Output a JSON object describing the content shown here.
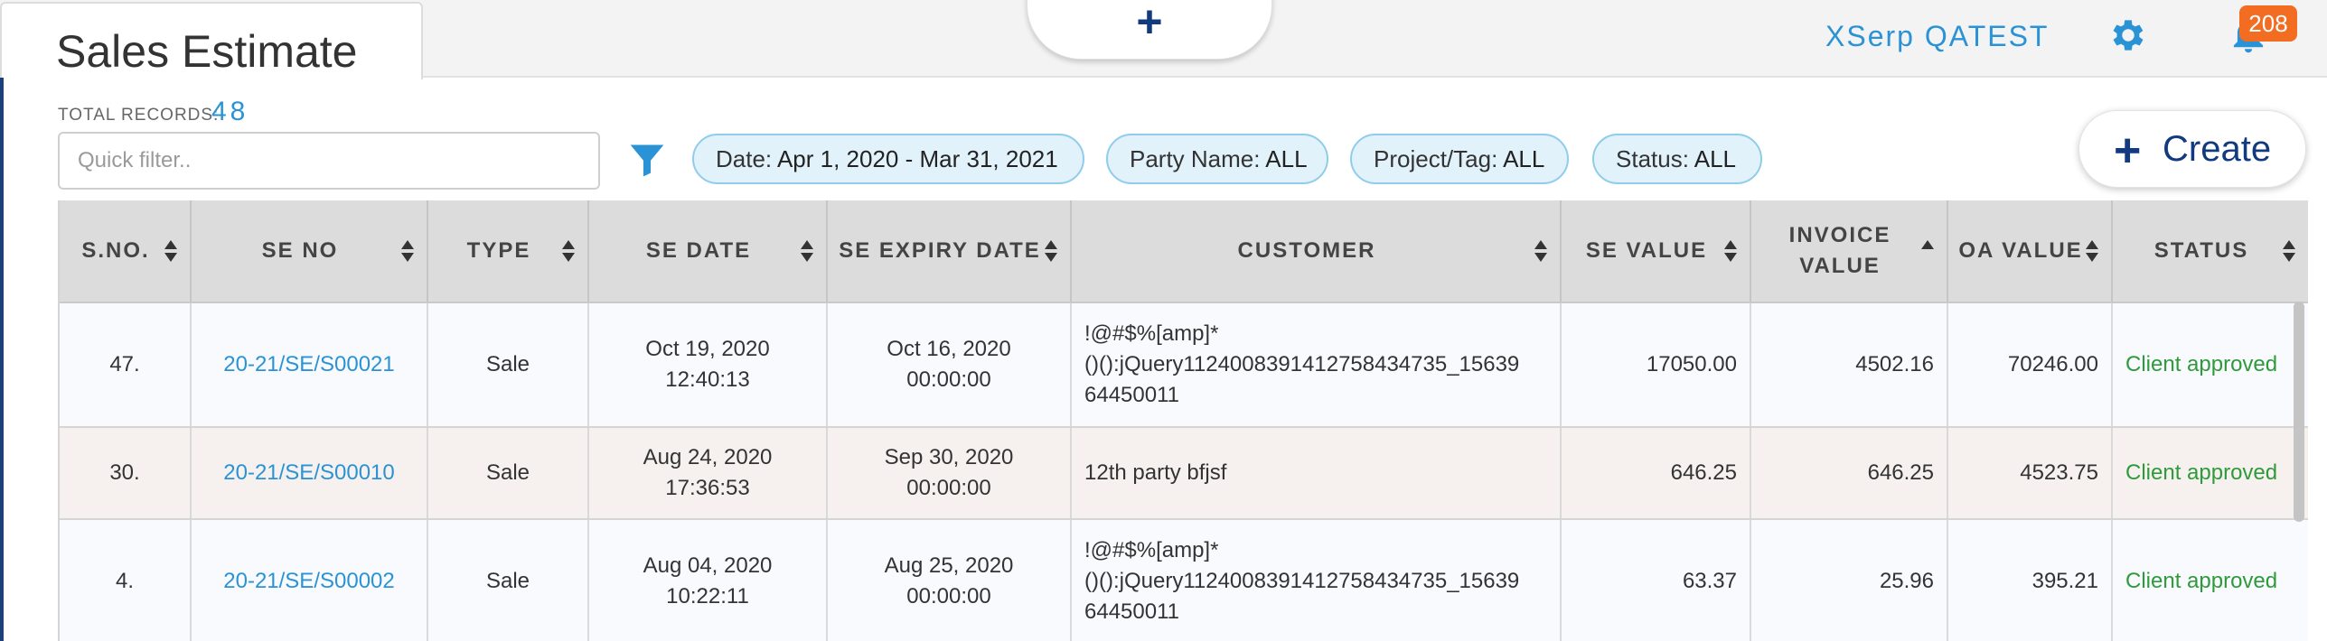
{
  "header": {
    "page_title": "Sales Estimate",
    "add_symbol": "+",
    "company_name": "XSerp QATEST",
    "notification_count": "208"
  },
  "toolbar": {
    "total_records_label": "TOTAL RECORDS:",
    "total_records_value": "48",
    "quick_filter_placeholder": "Quick filter..",
    "chips": [
      {
        "key": "Date:",
        "value": "Apr 1, 2020 - Mar 31, 2021"
      },
      {
        "key": "Party Name:",
        "value": "ALL"
      },
      {
        "key": "Project/Tag:",
        "value": "ALL"
      },
      {
        "key": "Status:",
        "value": "ALL"
      }
    ],
    "create_symbol": "+",
    "create_label": "Create"
  },
  "table": {
    "columns": [
      "S.NO.",
      "SE NO",
      "TYPE",
      "SE DATE",
      "SE EXPIRY DATE",
      "CUSTOMER",
      "SE VALUE",
      "INVOICE VALUE",
      "OA VALUE",
      "STATUS"
    ],
    "rows": [
      {
        "sno": "47.",
        "se_no": "20-21/SE/S00021",
        "type": "Sale",
        "se_date": "Oct 19, 2020",
        "se_time": "12:40:13",
        "exp_date": "Oct 16, 2020",
        "exp_time": "00:00:00",
        "customer_line1": "!@#$%[amp]*",
        "customer_line2": "()():jQuery1124008391412758434735_15639",
        "customer_line3": "64450011",
        "se_value": "17050.00",
        "invoice_value": "4502.16",
        "oa_value": "70246.00",
        "status": "Client approved"
      },
      {
        "sno": "30.",
        "se_no": "20-21/SE/S00010",
        "type": "Sale",
        "se_date": "Aug 24, 2020",
        "se_time": "17:36:53",
        "exp_date": "Sep 30, 2020",
        "exp_time": "00:00:00",
        "customer_line1": "12th party bfjsf",
        "customer_line2": "",
        "customer_line3": "",
        "se_value": "646.25",
        "invoice_value": "646.25",
        "oa_value": "4523.75",
        "status": "Client approved"
      },
      {
        "sno": "4.",
        "se_no": "20-21/SE/S00002",
        "type": "Sale",
        "se_date": "Aug 04, 2020",
        "se_time": "10:22:11",
        "exp_date": "Aug 25, 2020",
        "exp_time": "00:00:00",
        "customer_line1": "!@#$%[amp]*",
        "customer_line2": "()():jQuery1124008391412758434735_15639",
        "customer_line3": "64450011",
        "se_value": "63.37",
        "invoice_value": "25.96",
        "oa_value": "395.21",
        "status": "Client approved"
      }
    ]
  },
  "colors": {
    "accent_blue": "#2a93d5",
    "navy": "#123a7e",
    "badge_orange": "#f26c22",
    "status_green": "#2e9a3a",
    "chip_bg": "#e1f2fb"
  },
  "icons": [
    "add-icon",
    "gear-icon",
    "bell-icon",
    "filter-icon",
    "sort-icon"
  ]
}
